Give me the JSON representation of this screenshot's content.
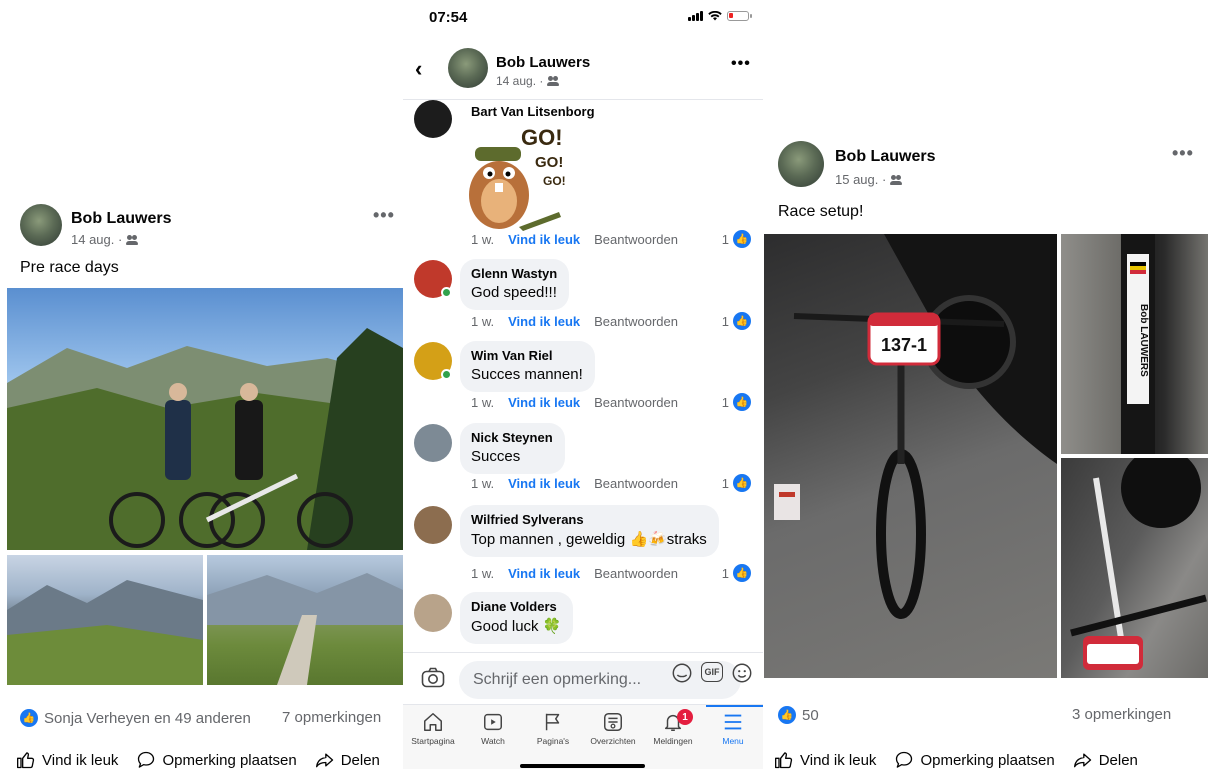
{
  "left_post": {
    "author": "Bob Lauwers",
    "date": "14 aug. ·",
    "more": "•••",
    "caption": "Pre race days",
    "reactions_text": "Sonja Verheyen en 49 anderen",
    "comments": "7 opmerkingen",
    "actions": {
      "like": "Vind ik leuk",
      "comment": "Opmerking plaatsen",
      "share": "Delen"
    }
  },
  "middle": {
    "status": {
      "time": "07:54"
    },
    "header": {
      "author": "Bob Lauwers",
      "date": "14 aug. ·",
      "more": "•••"
    },
    "comments": [
      {
        "name": "Bart Van Litsenborg",
        "text": "",
        "sticker": "GO! GO! GO!",
        "time": "1 w.",
        "like": "Vind ik leuk",
        "reply": "Beantwoorden",
        "count": "1",
        "online": false,
        "avatar_color": "#1c1c1c"
      },
      {
        "name": "Glenn Wastyn",
        "text": "God speed!!!",
        "time": "1 w.",
        "like": "Vind ik leuk",
        "reply": "Beantwoorden",
        "count": "1",
        "online": true,
        "avatar_color": "#c0392b"
      },
      {
        "name": "Wim Van Riel",
        "text": "Succes mannen!",
        "time": "1 w.",
        "like": "Vind ik leuk",
        "reply": "Beantwoorden",
        "count": "1",
        "online": true,
        "avatar_color": "#d4a017"
      },
      {
        "name": "Nick Steynen",
        "text": "Succes",
        "time": "1 w.",
        "like": "Vind ik leuk",
        "reply": "Beantwoorden",
        "count": "1",
        "online": false,
        "avatar_color": "#7d8a95"
      },
      {
        "name": "Wilfried Sylverans",
        "text": "Top mannen , geweldig 👍🍻straks",
        "time": "1 w.",
        "like": "Vind ik leuk",
        "reply": "Beantwoorden",
        "count": "1",
        "online": false,
        "avatar_color": "#8c6d4f"
      },
      {
        "name": "Diane Volders",
        "text": "Good luck 🍀",
        "online": false,
        "avatar_color": "#b8a38a"
      }
    ],
    "input": {
      "placeholder": "Schrijf een opmerking..."
    },
    "nav": {
      "home": "Startpagina",
      "watch": "Watch",
      "pages": "Pagina's",
      "overviews": "Overzichten",
      "notifications": "Meldingen",
      "notifications_badge": "1",
      "menu": "Menu"
    }
  },
  "right_post": {
    "author": "Bob Lauwers",
    "date": "15 aug. ·",
    "more": "•••",
    "caption": "Race setup!",
    "bib_number": "137-1",
    "bib_name": "Bob LAUWERS",
    "reactions_count": "50",
    "comments": "3 opmerkingen",
    "actions": {
      "like": "Vind ik leuk",
      "comment": "Opmerking plaatsen",
      "share": "Delen"
    }
  },
  "colors": {
    "accent": "#1877f2",
    "online": "#31a24c",
    "badge": "#e41e3f"
  }
}
